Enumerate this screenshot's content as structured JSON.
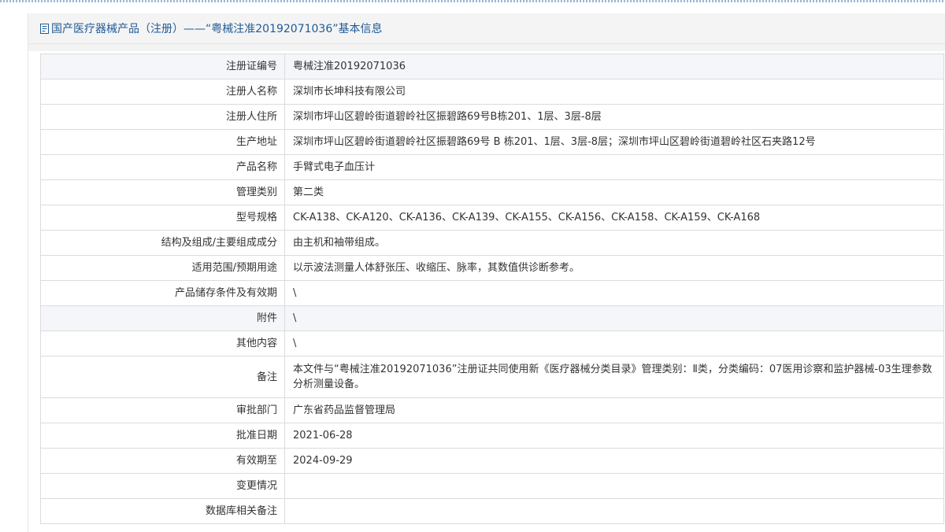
{
  "header": {
    "title": "国产医疗器械产品（注册）——“粤械注准20192071036”基本信息",
    "icon": "document-icon"
  },
  "rows": [
    {
      "label": "注册证编号",
      "value": "粤械注准20192071036"
    },
    {
      "label": "注册人名称",
      "value": "深圳市长坤科技有限公司"
    },
    {
      "label": "注册人住所",
      "value": "深圳市坪山区碧岭街道碧岭社区振碧路69号B栋201、1层、3层-8层"
    },
    {
      "label": "生产地址",
      "value": "深圳市坪山区碧岭街道碧岭社区振碧路69号 B 栋201、1层、3层-8层；深圳市坪山区碧岭街道碧岭社区石夹路12号"
    },
    {
      "label": "产品名称",
      "value": "手臂式电子血压计"
    },
    {
      "label": "管理类别",
      "value": "第二类"
    },
    {
      "label": "型号规格",
      "value": "CK-A138、CK-A120、CK-A136、CK-A139、CK-A155、CK-A156、CK-A158、CK-A159、CK-A168"
    },
    {
      "label": "结构及组成/主要组成成分",
      "value": "由主机和袖带组成。"
    },
    {
      "label": "适用范围/预期用途",
      "value": "以示波法测量人体舒张压、收缩压、脉率，其数值供诊断参考。"
    },
    {
      "label": "产品储存条件及有效期",
      "value": "\\"
    },
    {
      "label": "附件",
      "value": "\\"
    },
    {
      "label": "其他内容",
      "value": "\\"
    },
    {
      "label": "备注",
      "value": "本文件与“粤械注准20192071036”注册证共同使用新《医疗器械分类目录》管理类别：Ⅱ类，分类编码：07医用诊察和监护器械-03生理参数分析测量设备。"
    },
    {
      "label": "审批部门",
      "value": "广东省药品监督管理局"
    },
    {
      "label": "批准日期",
      "value": "2021-06-28"
    },
    {
      "label": "有效期至",
      "value": "2024-09-29"
    },
    {
      "label": "变更情况",
      "value": ""
    },
    {
      "label": "数据库相关备注",
      "value": ""
    }
  ]
}
